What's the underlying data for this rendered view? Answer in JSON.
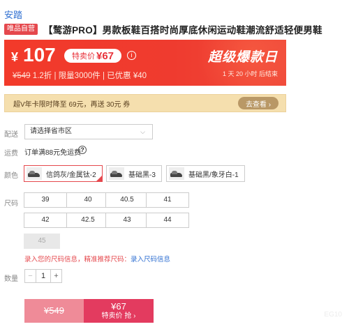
{
  "store": {
    "brand": "安踏"
  },
  "product": {
    "badge": "唯品自营",
    "title": "【鹜游PRO】男款板鞋百搭时尚厚底休闲运动鞋潮流舒适轻便男鞋"
  },
  "price": {
    "currency": "¥",
    "current": "107",
    "special_label": "特卖价",
    "special_value": "¥67",
    "info_icon": "info-icon",
    "original": "¥549",
    "discount": "1.2折",
    "limit": "限量3000件",
    "coupon": "已优惠 ¥40",
    "event_title": "超级爆款日",
    "countdown": "1 天 20 小时 后结束"
  },
  "vip": {
    "text": "超V年卡限时降至 69元，再送 30元 券",
    "button": "去查看 ›"
  },
  "delivery": {
    "label": "配送",
    "placeholder": "请选择省市区",
    "chevron": "⌵"
  },
  "shipping": {
    "label": "运费",
    "text": "订单满88元免运费",
    "help": "?"
  },
  "colors": {
    "label": "颜色",
    "options": [
      "信鸽灰/金属钛-2",
      "基础黑-3",
      "基础黑/象牙白-1"
    ]
  },
  "sizes": {
    "label": "尺码",
    "options": [
      "39",
      "40",
      "40.5",
      "41",
      "42",
      "42.5",
      "43",
      "44",
      "45"
    ],
    "tip_prefix": "录入您的尺码信息，精准推荐尺码：",
    "tip_link": "录入尺码信息"
  },
  "quantity": {
    "label": "数量",
    "minus": "−",
    "value": "1",
    "plus": "+"
  },
  "buy": {
    "left_price": "¥549",
    "right_price": "¥67",
    "right_label": "特卖价 抢 ›"
  },
  "watermark": "EG10"
}
